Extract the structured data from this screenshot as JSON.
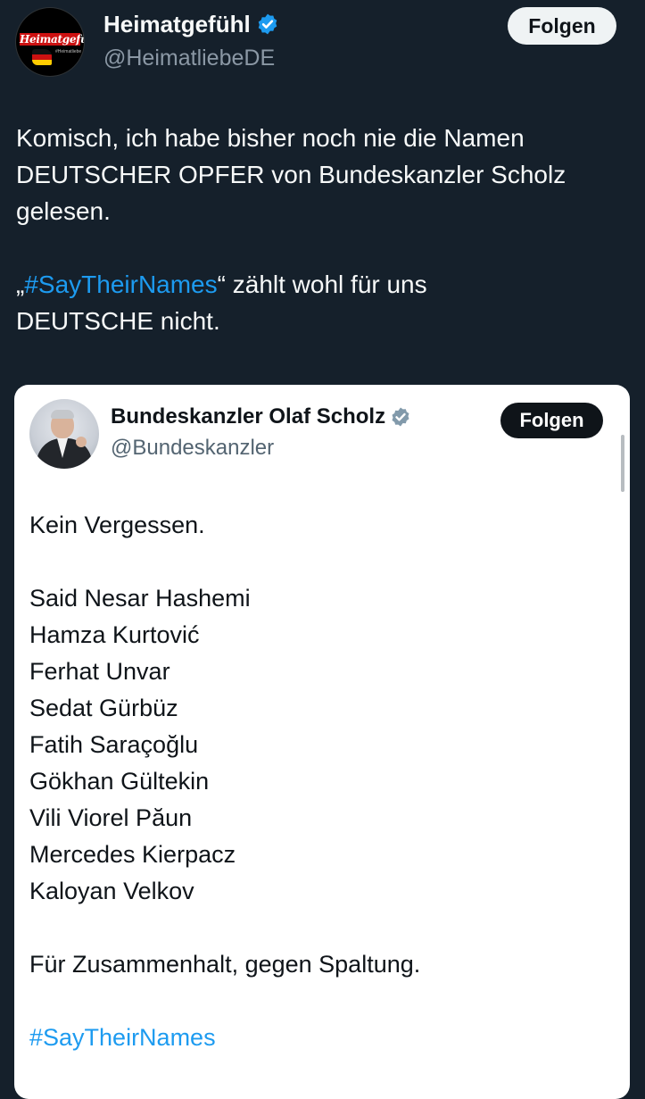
{
  "outer_tweet": {
    "avatar_logo_text": "Heimatgefühl",
    "avatar_small_text": "#Heimatliebe",
    "display_name": "Heimatgefühl",
    "handle": "@HeimatliebeDE",
    "follow_label": "Folgen",
    "verified_icon": "blue-verified-badge",
    "text": {
      "line1": "Komisch, ich habe bisher noch nie die Namen",
      "line2": "DEUTSCHER OPFER von Bundeskanzler Scholz",
      "line3": "gelesen.",
      "quote_open": "„",
      "hashtag": "#SayTheirNames",
      "quote_rest": "“ zählt wohl für uns",
      "line5": "DEUTSCHE nicht."
    }
  },
  "quoted_tweet": {
    "display_name": "Bundeskanzler Olaf Scholz",
    "handle": "@Bundeskanzler",
    "follow_label": "Folgen",
    "verified_icon": "gray-verified-badge",
    "intro": "Kein Vergessen.",
    "names": [
      "Said Nesar Hashemi",
      "Hamza Kurtović",
      "Ferhat Unvar",
      "Sedat Gürbüz",
      "Fatih Saraçoğlu",
      "Gökhan Gültekin",
      "Vili Viorel Păun",
      "Mercedes Kierpacz",
      "Kaloyan Velkov"
    ],
    "closing": "Für Zusammenhalt, gegen Spaltung.",
    "hashtag": "#SayTheirNames"
  },
  "colors": {
    "background": "#15202b",
    "link_blue": "#1d9bf0",
    "verified_blue": "#1d9bf0",
    "verified_gray": "#829aab"
  }
}
